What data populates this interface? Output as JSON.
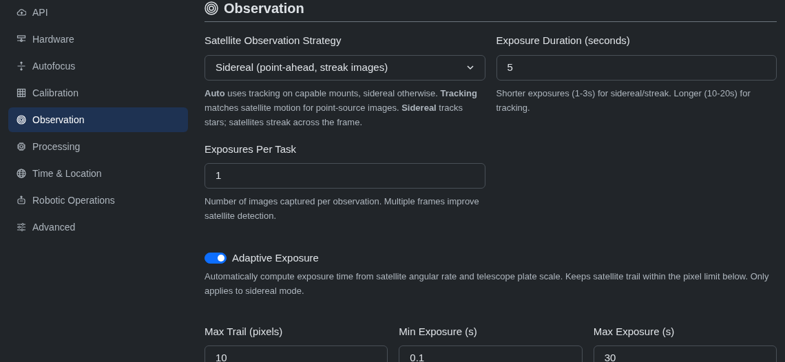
{
  "sidebar": {
    "items": [
      {
        "label": "API",
        "selected": false
      },
      {
        "label": "Hardware",
        "selected": false
      },
      {
        "label": "Autofocus",
        "selected": false
      },
      {
        "label": "Calibration",
        "selected": false
      },
      {
        "label": "Observation",
        "selected": true
      },
      {
        "label": "Processing",
        "selected": false
      },
      {
        "label": "Time & Location",
        "selected": false
      },
      {
        "label": "Robotic Operations",
        "selected": false
      },
      {
        "label": "Advanced",
        "selected": false
      }
    ]
  },
  "section": {
    "title": "Observation",
    "rows": [
      [
        {
          "kind": "select",
          "label": "Satellite Observation Strategy",
          "value": "Sidereal (point-ahead, streak images)",
          "help": "**Auto** uses tracking on capable mounts, sidereal otherwise. **Tracking** matches satellite motion for point-source images. **Sidereal** tracks stars; satellites streak across the frame."
        },
        {
          "kind": "input",
          "label": "Exposure Duration (seconds)",
          "value": "5",
          "help": "Shorter exposures (1-3s) for sidereal/streak. Longer (10-20s) for tracking."
        }
      ],
      [
        {
          "kind": "input",
          "label": "Exposures Per Task",
          "value": "1",
          "help": "Number of images captured per observation. Multiple frames improve satellite detection."
        }
      ]
    ],
    "toggle": {
      "label": "Adaptive Exposure",
      "checked": true,
      "help": "Automatically compute exposure time from satellite angular rate and telescope plate scale. Keeps satellite trail within the pixel limit below. Only applies to sidereal mode."
    },
    "limits": [
      {
        "label": "Max Trail (pixels)",
        "value": "10"
      },
      {
        "label": "Min Exposure (s)",
        "value": "0.1"
      },
      {
        "label": "Max Exposure (s)",
        "value": "30"
      }
    ]
  }
}
